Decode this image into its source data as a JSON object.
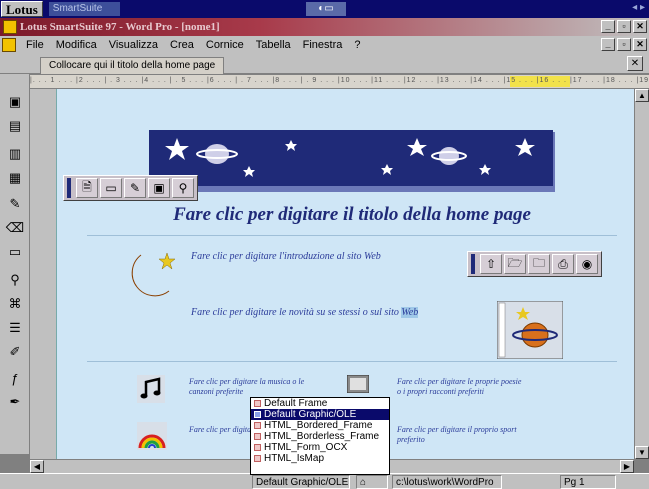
{
  "smartsuite": {
    "logo": "Lotus",
    "tab": "SmartSuite"
  },
  "window": {
    "title": "Lotus SmartSuite 97 - Word Pro - [nome1]"
  },
  "menu": {
    "items": [
      {
        "label": "File",
        "underline": "F"
      },
      {
        "label": "Modifica",
        "underline": "M"
      },
      {
        "label": "Visualizza",
        "underline": "V"
      },
      {
        "label": "Crea",
        "underline": "C"
      },
      {
        "label": "Cornice",
        "underline": "o"
      },
      {
        "label": "Tabella",
        "underline": "b"
      },
      {
        "label": "Finestra",
        "underline": "n"
      },
      {
        "label": "?",
        "underline": "?"
      }
    ]
  },
  "document_tab": {
    "label": "Collocare qui il titolo della home page"
  },
  "ruler": {
    "marks": "|. . . 1 . . . |2 . . . | . 3 . . . |4 . . . | . 5 . . . |6 . . . | . 7 . . . |8 . . . | . 9 . . . |10 . . . |11 . . . |12 . . . |13 . . . |14 . . . |15 . . . |16 . . . |17 . . . |18 . . . |19 . . . |20"
  },
  "page": {
    "home_title": "Fare clic per digitare il titolo della home page",
    "intro_text": "Fare clic per digitare l'introduzione al sito Web",
    "news_text_before": "Fare clic per digitare le novità su se stessi o sul sito ",
    "news_text_hl": "Web",
    "music_text": "Fare clic per digitare la musica o le canzoni preferite",
    "hobby_text": "Fare clic per digitare le proprie scelte",
    "poetry_text": "Fare clic per digitare le proprie poesie o i propri racconti preferiti",
    "sport_text": "Fare clic per digitare il proprio sport preferito"
  },
  "dropdown": {
    "items": [
      {
        "label": "Default Frame",
        "selected": false
      },
      {
        "label": "Default Graphic/OLE",
        "selected": true
      },
      {
        "label": "HTML_Bordered_Frame",
        "selected": false
      },
      {
        "label": "HTML_Borderless_Frame",
        "selected": false
      },
      {
        "label": "HTML_Form_OCX",
        "selected": false
      },
      {
        "label": "HTML_IsMap",
        "selected": false
      }
    ]
  },
  "statusbar": {
    "style": "Default Graphic/OLE",
    "path": "c:\\lotus\\work\\WordPro",
    "page": "Pg 1"
  },
  "colors": {
    "page_bg": "#cfe6f6",
    "title_blue": "#1f2a78",
    "banner": "#1f2a78",
    "selection": "#0a0a6b"
  }
}
